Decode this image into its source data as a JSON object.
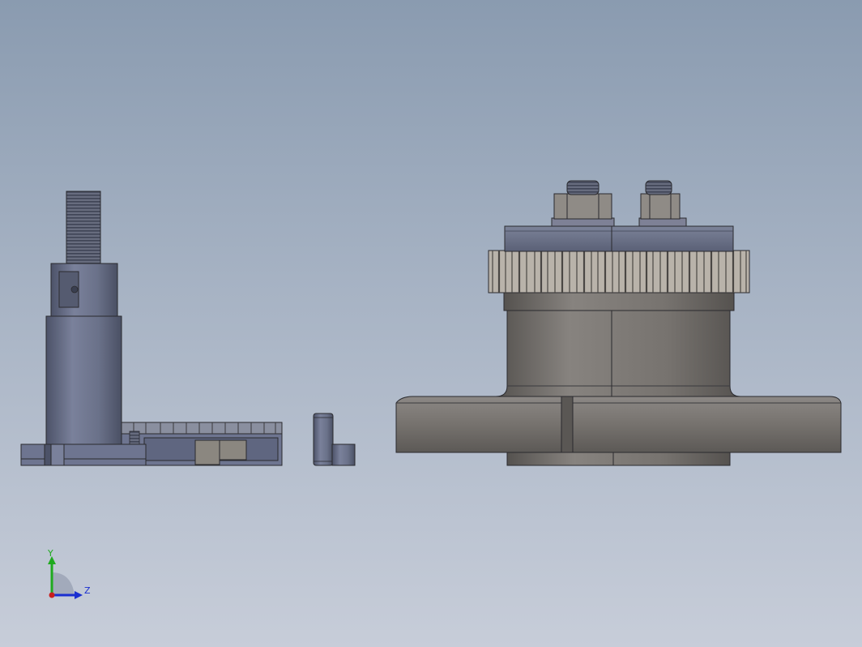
{
  "viewport": {
    "background_top": "#8a9bb0",
    "background_bottom": "#c7cdd9",
    "model_parts": [
      "shaft-assembly",
      "dowel-pin",
      "gear-hub-assembly"
    ]
  },
  "triad": {
    "y_label": "Y",
    "z_label": "Z",
    "y_color": "#1faa1f",
    "z_color": "#1a2fd0",
    "x_color": "#c81e1e"
  },
  "colors": {
    "metal_blue": "#6f7690",
    "metal_blue_dark": "#4c5268",
    "metal_grey": "#7a7775",
    "metal_grey_dark": "#55524f",
    "outline": "#2a2a2e"
  }
}
